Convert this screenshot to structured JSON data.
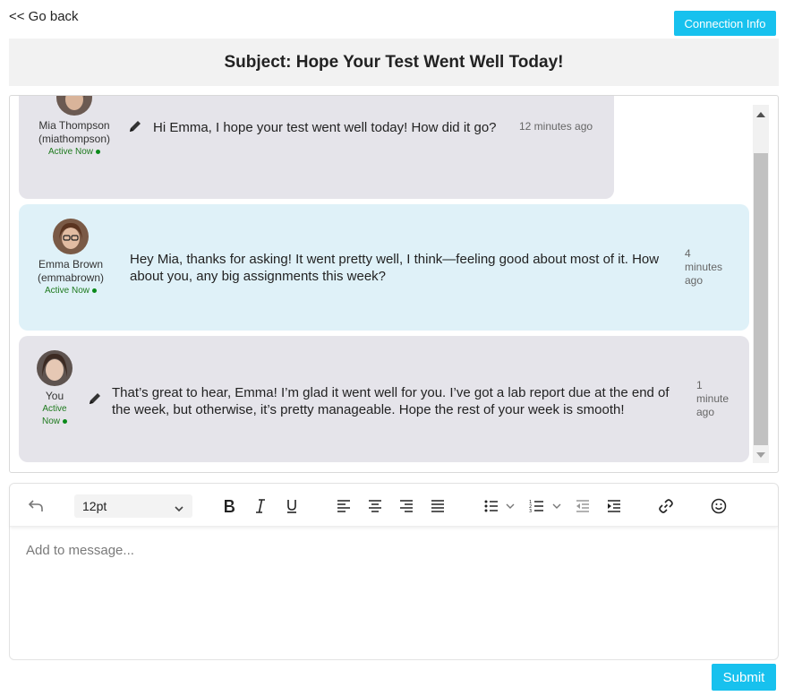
{
  "nav": {
    "go_back": "<< Go back",
    "connection_info": "Connection Info"
  },
  "subject": "Subject: Hope Your Test Went Well Today!",
  "messages": [
    {
      "sender_name": "Mia Thompson",
      "sender_handle": "(miathompson)",
      "status": "Active Now",
      "text": "Hi Emma, I hope your test went well today! How did it go?",
      "time": "12 minutes ago",
      "editable": true
    },
    {
      "sender_name": "Emma Brown",
      "sender_handle": "(emmabrown)",
      "status": "Active Now",
      "text": "Hey Mia, thanks for asking! It went pretty well, I think—feeling good about most of it. How about you, any big assignments this week?",
      "time_line1": "4",
      "time_line2": "minutes",
      "time_line3": "ago",
      "editable": false
    },
    {
      "sender_name": "You",
      "status_line1": "Active",
      "status_line2": "Now",
      "text": "That’s great to hear, Emma! I’m glad it went well for you. I’ve got a lab report due at the end of the week, but otherwise, it’s pretty manageable. Hope the rest of your week is smooth!",
      "time_line1": "1",
      "time_line2": "minute",
      "time_line3": "ago",
      "editable": true
    }
  ],
  "editor": {
    "font_size": "12pt",
    "placeholder": "Add to message...",
    "tools": [
      "undo-icon",
      "bold-icon",
      "italic-icon",
      "underline-icon",
      "align-left-icon",
      "align-center-icon",
      "align-right-icon",
      "align-justify-icon",
      "bullet-list-icon",
      "numbered-list-icon",
      "outdent-icon",
      "indent-icon",
      "link-icon",
      "emoji-icon"
    ]
  },
  "submit_label": "Submit",
  "colors": {
    "accent": "#17c1ee",
    "message_gray": "#e5e4ea",
    "message_blue": "#dff1f8",
    "status_green": "#1e7a1e"
  }
}
